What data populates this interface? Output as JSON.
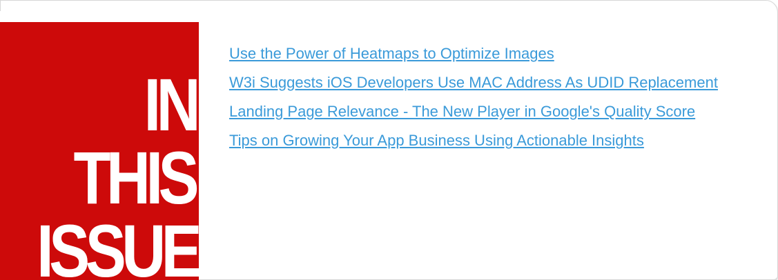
{
  "banner": {
    "lines": [
      "IN",
      "THIS",
      "ISSUE"
    ],
    "color": "#cd0a0a"
  },
  "articles": [
    {
      "title": "Use the Power of Heatmaps to Optimize Images"
    },
    {
      "title": "W3i Suggests iOS Developers Use MAC Address As UDID Replacement"
    },
    {
      "title": "Landing Page Relevance - The New Player in Google's Quality Score"
    },
    {
      "title": "Tips on Growing Your App Business Using Actionable Insights"
    }
  ],
  "link_color": "#3a9ad9"
}
